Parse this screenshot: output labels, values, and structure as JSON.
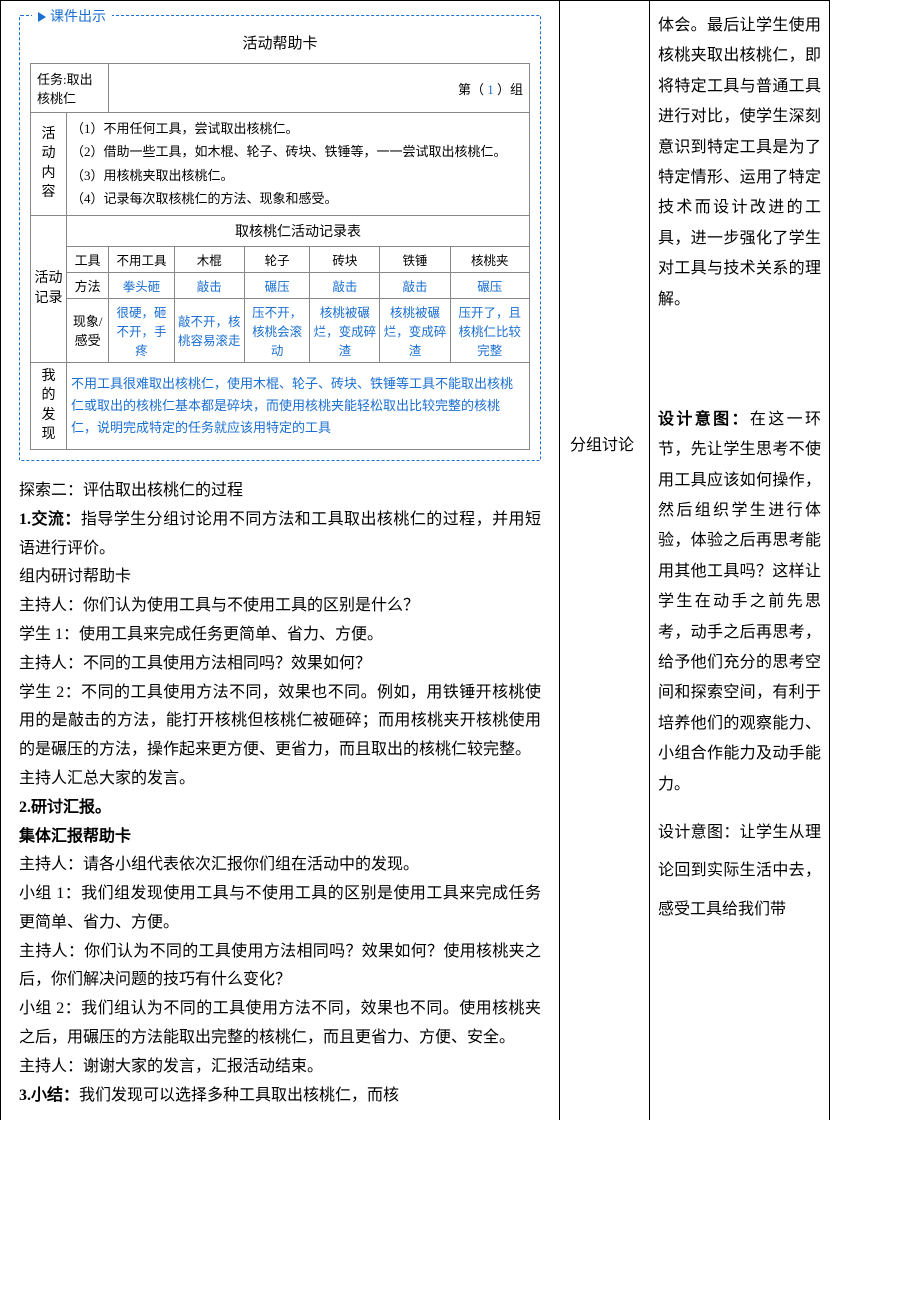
{
  "courseware": {
    "badge": "课件出示",
    "helpTitle": "活动帮助卡",
    "taskLabel": "任务:取出核桃仁",
    "groupPrefix": "第（",
    "groupNum": "1",
    "groupSuffix": "）组",
    "sideHeads": {
      "content": "活动内容",
      "record": "活动记录",
      "finding": "我的发现"
    },
    "contentLines": [
      "（1）不用任何工具，尝试取出核桃仁。",
      "（2）借助一些工具，如木棍、轮子、砖块、铁锤等，一一尝试取出核桃仁。",
      "（3）用核桃夹取出核桃仁。",
      "（4）记录每次取核桃仁的方法、现象和感受。"
    ],
    "recordTitle": "取核桃仁活动记录表",
    "recordHeaders": [
      "工具",
      "不用工具",
      "木棍",
      "轮子",
      "砖块",
      "铁锤",
      "核桃夹"
    ],
    "methodRowLabel": "方法",
    "methodRow": [
      "拳头砸",
      "敲击",
      "碾压",
      "敲击",
      "敲击",
      "碾压"
    ],
    "feelRowLabel": "现象/感受",
    "feelRow": [
      "很硬，砸不开，手疼",
      "敲不开，核桃容易滚走",
      "压不开，核桃会滚动",
      "核桃被碾烂，变成碎渣",
      "核桃被碾烂，变成碎渣",
      "压开了，且核桃仁比较完整"
    ],
    "findingText": "不用工具很难取出核桃仁，使用木棍、轮子、砖块、铁锤等工具不能取出核桃仁或取出的核桃仁基本都是碎块，而使用核桃夹能轻松取出比较完整的核桃仁，说明完成特定的任务就应该用特定的工具"
  },
  "middle": {
    "discuss": "分组讨论"
  },
  "body": {
    "explore2Title": "探索二：评估取出核桃仁的过程",
    "s1Label": "1.交流：",
    "s1Text": "指导学生分组讨论用不同方法和工具取出核桃仁的过程，并用短语进行评价。",
    "groupCardTitle": "组内研讨帮助卡",
    "q1": "主持人：你们认为使用工具与不使用工具的区别是什么？",
    "a1": "学生 1：使用工具来完成任务更简单、省力、方便。",
    "q2": "主持人：不同的工具使用方法相同吗？效果如何？",
    "a2": "学生 2：不同的工具使用方法不同，效果也不同。例如，用铁锤开核桃使用的是敲击的方法，能打开核桃但核桃仁被砸碎；而用核桃夹开核桃使用的是碾压的方法，操作起来更方便、更省力，而且取出的核桃仁较完整。",
    "sum": "主持人汇总大家的发言。",
    "s2Label": "2.研讨汇报。",
    "collectiveTitle": "集体汇报帮助卡",
    "cq1": "主持人：请各小组代表依次汇报你们组在活动中的发现。",
    "ca1": "小组 1：我们组发现使用工具与不使用工具的区别是使用工具来完成任务更简单、省力、方便。",
    "cq2": "主持人：你们认为不同的工具使用方法相同吗？效果如何？使用核桃夹之后，你们解决问题的技巧有什么变化？",
    "ca2": "小组 2：我们组认为不同的工具使用方法不同，效果也不同。使用核桃夹之后，用碾压的方法能取出完整的核桃仁，而且更省力、方便、安全。",
    "thanks": "主持人：谢谢大家的发言，汇报活动结束。",
    "s3Label": "3.小结：",
    "s3Text": "我们发现可以选择多种工具取出核桃仁，而核"
  },
  "right": {
    "para0": "体会。最后让学生使用核桃夹取出核桃仁，即将特定工具与普通工具进行对比，使学生深刻意识到特定工具是为了特定情形、运用了特定技术而设计改进的工具，进一步强化了学生对工具与技术关系的理解。",
    "design1Label": "设计意图：",
    "design1Text": "在这一环节，先让学生思考不使用工具应该如何操作，然后组织学生进行体验，体验之后再思考能用其他工具吗？这样让学生在动手之前先思考，动手之后再思考，给予他们充分的思考空间和探索空间，有利于培养他们的观察能力、小组合作能力及动手能力。",
    "design2": "设计意图：让学生从理论回到实际生活中去，感受工具给我们带"
  }
}
